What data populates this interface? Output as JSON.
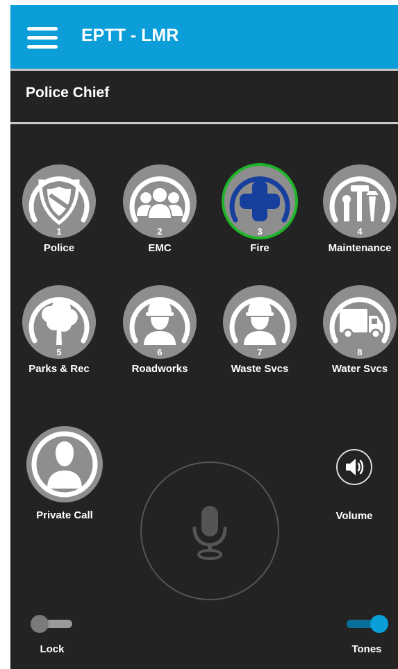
{
  "app": {
    "title": "EPTT - LMR"
  },
  "subheader": {
    "title": "Police Chief"
  },
  "talkgroups": [
    {
      "number": "1",
      "label": "Police",
      "icon": "shield-icon",
      "selected": false
    },
    {
      "number": "2",
      "label": "EMC",
      "icon": "group-icon",
      "selected": false
    },
    {
      "number": "3",
      "label": "Fire",
      "icon": "medical-cross-icon",
      "selected": true
    },
    {
      "number": "4",
      "label": "Maintenance",
      "icon": "tools-icon",
      "selected": false
    },
    {
      "number": "5",
      "label": "Parks & Rec",
      "icon": "tree-icon",
      "selected": false
    },
    {
      "number": "6",
      "label": "Roadworks",
      "icon": "hardhat-worker-icon",
      "selected": false
    },
    {
      "number": "7",
      "label": "Waste Svcs",
      "icon": "hardhat-worker-icon",
      "selected": false
    },
    {
      "number": "8",
      "label": "Water Svcs",
      "icon": "truck-icon",
      "selected": false
    }
  ],
  "private_call": {
    "label": "Private Call",
    "icon": "person-icon"
  },
  "volume": {
    "label": "Volume",
    "icon": "speaker-icon"
  },
  "ptt": {
    "icon": "microphone-icon"
  },
  "lock": {
    "label": "Lock",
    "on": false
  },
  "tones": {
    "label": "Tones",
    "on": true
  },
  "colors": {
    "appbar": "#0b9ed9",
    "background": "#232323",
    "selected_ring": "#1fb52a",
    "fire_icon": "#163f9e",
    "toggle_on": "#0b9ed9"
  }
}
